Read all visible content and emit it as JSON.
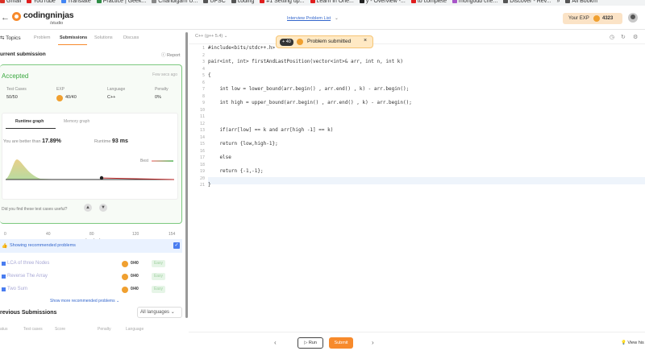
{
  "bookmarks": [
    {
      "label": "Gmail",
      "color": "#d93025"
    },
    {
      "label": "YouTube",
      "color": "#e01d1d"
    },
    {
      "label": "Translate",
      "color": "#4285f4"
    },
    {
      "label": "Practice | Geek...",
      "color": "#2f8d46"
    },
    {
      "label": "Chandigarh U...",
      "color": "#888888"
    },
    {
      "label": "UPSC",
      "color": "#555555"
    },
    {
      "label": "coding",
      "color": "#555555"
    },
    {
      "label": "#1 Setting up...",
      "color": "#e01d1d"
    },
    {
      "label": "Learn in One...",
      "color": "#e01d1d"
    },
    {
      "label": "y - Overview -...",
      "color": "#222222"
    },
    {
      "label": "to complete",
      "color": "#e01d1d"
    },
    {
      "label": "mongodb che...",
      "color": "#a855c8"
    },
    {
      "label": "Discover - Rev...",
      "color": "#555555"
    },
    {
      "label": "»",
      "color": ""
    },
    {
      "label": "All Bookm",
      "color": "#555555"
    }
  ],
  "header": {
    "back": "←",
    "brand": "codingninjas",
    "brand_sub": "/studio",
    "problem_list": "Interview Problem List",
    "exp_label": "Your EXP",
    "exp_value": "4323"
  },
  "tabs": {
    "topics": "Topics",
    "problem": "Problem",
    "submissions": "Submissions",
    "solutions": "Solutions",
    "discuss": "Discuss"
  },
  "submission": {
    "title": "urrent submission",
    "report": "Report",
    "status": "Accepted",
    "ago": "Few secs ago",
    "test_cases_label": "Test Cases",
    "test_cases": "50/50",
    "exp_label": "EXP",
    "exp": "40/40",
    "language_label": "Language",
    "language": "C++",
    "penalty_label": "Penalty",
    "penalty": "0%"
  },
  "graph": {
    "tab_runtime": "Runtime graph",
    "tab_memory": "Memory graph",
    "beat_prefix": "You are better than",
    "beat_value": "17.89%",
    "runtime_label": "Runtime",
    "runtime_value": "93 ms",
    "best": "Best",
    "ticks": [
      "0",
      "40",
      "80",
      "120",
      "154"
    ],
    "axis": "Runtime (ms)",
    "useful": "Did you find these test cases useful?"
  },
  "recommended": {
    "label": "Showing recommended problems",
    "problems": [
      {
        "name": "LCA of three Nodes",
        "score": "0/40",
        "difficulty": "Easy"
      },
      {
        "name": "Reverse The Array",
        "score": "0/40",
        "difficulty": "Easy"
      },
      {
        "name": "Two Sum",
        "score": "0/40",
        "difficulty": "Easy"
      }
    ],
    "more": "Show more recommended problems ⌄"
  },
  "previous": {
    "title": "revious Submissions",
    "lang_select": "All languages",
    "headers": [
      "atus",
      "Test cases",
      "Score",
      "Penalty",
      "Language"
    ]
  },
  "editor": {
    "language": "C++ (g++ 5.4)  ⌄",
    "toast_badge": "+ 40",
    "toast_msg": "Problem submitted",
    "toast_close": "×",
    "lines": [
      "#include<bits/stdc++.h>",
      "",
      "pair<int, int> firstAndLastPosition(vector<int>& arr, int n, int k)",
      "",
      "{",
      "",
      "    int low = lower_bound(arr.begin() , arr.end() , k) - arr.begin();",
      "",
      "    int high = upper_bound(arr.begin() , arr.end() , k) - arr.begin();",
      "",
      "",
      "",
      "    if(arr[low] == k and arr[high -1] == k)",
      "",
      "    return {low,high-1};",
      "",
      "    else",
      "",
      "    return {-1,-1};",
      "",
      "}"
    ]
  },
  "footer": {
    "prev": "‹",
    "run": "Run",
    "submit": "Submit",
    "next": "›",
    "view": "View his"
  }
}
